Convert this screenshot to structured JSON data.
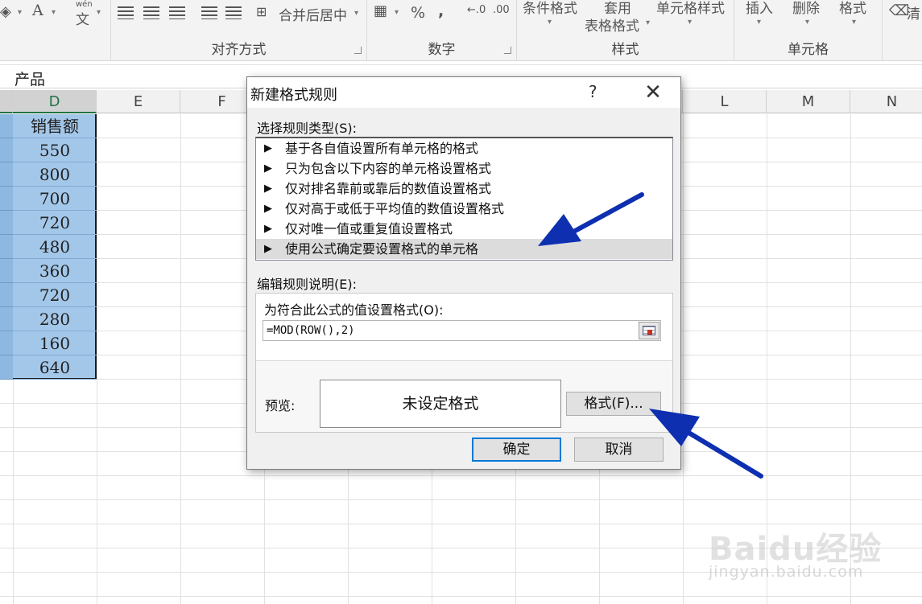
{
  "ribbon": {
    "groups": [
      {
        "label": "对齐方式"
      },
      {
        "label": "数字"
      },
      {
        "label": "样式"
      },
      {
        "label": "单元格"
      }
    ],
    "merge_label": "合并后居中",
    "percent": "%",
    "comma": ",",
    "cond_format_label": "条件格式",
    "table_format_top": "套用",
    "table_format_bottom": "表格格式",
    "cell_style_label": "单元格样式",
    "insert_label": "插入",
    "delete_label": "删除",
    "format_label": "格式",
    "clear_label": "清",
    "font_a": "A",
    "wen": "wén",
    "wen_char": "文"
  },
  "formula_bar": {
    "value": "产品"
  },
  "columns": [
    {
      "label": "D",
      "selected": true
    },
    {
      "label": "E"
    },
    {
      "label": "F"
    },
    {
      "label": "L"
    },
    {
      "label": "M"
    },
    {
      "label": "N"
    }
  ],
  "column_d": {
    "header": "销售额",
    "values": [
      "550",
      "800",
      "700",
      "720",
      "480",
      "360",
      "720",
      "280",
      "160",
      "640"
    ]
  },
  "dialog": {
    "title": "新建格式规则",
    "help": "?",
    "close": "✕",
    "rule_type_label": "选择规则类型(S):",
    "rule_types": [
      "基于各自值设置所有单元格的格式",
      "只为包含以下内容的单元格设置格式",
      "仅对排名靠前或靠后的数值设置格式",
      "仅对高于或低于平均值的数值设置格式",
      "仅对唯一值或重复值设置格式",
      "使用公式确定要设置格式的单元格"
    ],
    "selected_rule_index": 5,
    "rule_arrow": "▶",
    "edit_label": "编辑规则说明(E):",
    "formula_label": "为符合此公式的值设置格式(O):",
    "formula_value": "=MOD(ROW(),2)",
    "preview_label": "预览:",
    "preview_text": "未设定格式",
    "format_button": "格式(F)...",
    "ok_button": "确定",
    "cancel_button": "取消"
  },
  "watermark": {
    "brand": "Baidu经验",
    "url": "jingyan.baidu.com"
  },
  "colors": {
    "selection": "#a3c7e9",
    "arrow": "#0d2fb0",
    "excel_green": "#217346"
  }
}
